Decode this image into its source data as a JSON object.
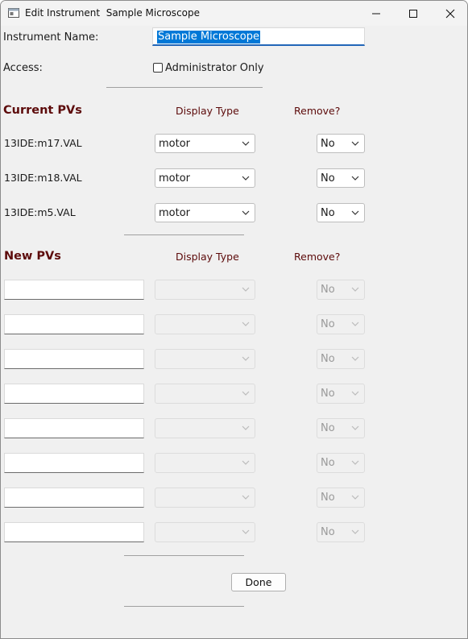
{
  "window": {
    "title": "Edit Instrument  Sample Microscope"
  },
  "form": {
    "name_label": "Instrument Name:",
    "name_value": "Sample Microscope",
    "access_label": "Access:",
    "admin_only_label": "Administrator Only",
    "admin_only_checked": false
  },
  "current_pvs": {
    "title": "Current PVs",
    "display_type_header": "Display Type",
    "remove_header": "Remove?",
    "rows": [
      {
        "name": "13IDE:m17.VAL",
        "display_type": "motor",
        "remove": "No"
      },
      {
        "name": "13IDE:m18.VAL",
        "display_type": "motor",
        "remove": "No"
      },
      {
        "name": "13IDE:m5.VAL",
        "display_type": "motor",
        "remove": "No"
      }
    ]
  },
  "new_pvs": {
    "title": "New PVs",
    "display_type_header": "Display Type",
    "remove_header": "Remove?",
    "rows": [
      {
        "name": "",
        "display_type": "",
        "remove": "No"
      },
      {
        "name": "",
        "display_type": "",
        "remove": "No"
      },
      {
        "name": "",
        "display_type": "",
        "remove": "No"
      },
      {
        "name": "",
        "display_type": "",
        "remove": "No"
      },
      {
        "name": "",
        "display_type": "",
        "remove": "No"
      },
      {
        "name": "",
        "display_type": "",
        "remove": "No"
      },
      {
        "name": "",
        "display_type": "",
        "remove": "No"
      },
      {
        "name": "",
        "display_type": "",
        "remove": "No"
      }
    ]
  },
  "buttons": {
    "done": "Done"
  },
  "icons": {
    "app": "window-app-icon",
    "minimize": "minimize-icon",
    "maximize": "maximize-icon",
    "close": "close-icon",
    "dropdown": "chevron-down-icon"
  },
  "colors": {
    "section_title": "#5c0a0a",
    "selection": "#0078d7",
    "focus_underline": "#2266b8",
    "background": "#f0f0f0"
  }
}
